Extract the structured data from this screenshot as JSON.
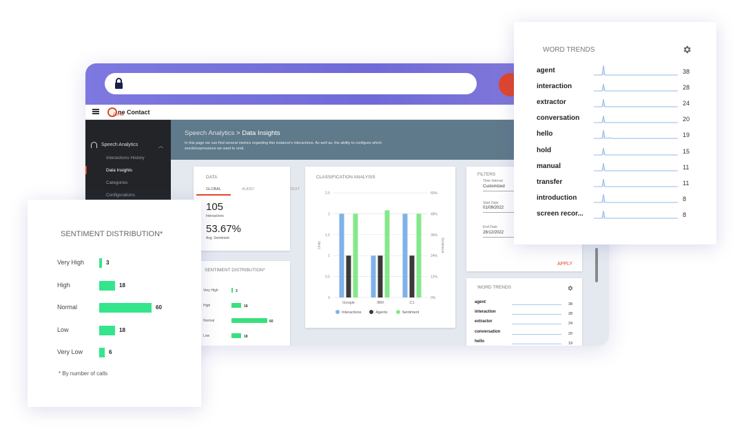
{
  "app": {
    "logo_main": "ne Contact",
    "logo_sub": "Portal"
  },
  "sidebar": {
    "section": "Speech Analytics",
    "items": [
      {
        "label": "Interactions History"
      },
      {
        "label": "Data Insights"
      },
      {
        "label": "Categories"
      },
      {
        "label": "Configurations"
      }
    ]
  },
  "header": {
    "crumb_parent": "Speech Analytics",
    "crumb_sep": ">",
    "crumb_current": "Data Insights",
    "description": "In this page we can find several metrics regarding this instance's interactions. As well as, the ability to configure which words/expressions we want to omit."
  },
  "data_card": {
    "title": "DATA",
    "tabs": [
      "GLOBAL",
      "AUDIO",
      "TEXT"
    ],
    "interactions_value": "105",
    "interactions_label": "Interactions",
    "sentiment_value": "53.67%",
    "sentiment_label": "Avg. Sentiment"
  },
  "small_sentiment": {
    "title": "SENTIMENT DISTRIBUTION*",
    "rows": [
      {
        "label": "Very High",
        "value": 3
      },
      {
        "label": "High",
        "value": 18
      },
      {
        "label": "Normal",
        "value": 60
      },
      {
        "label": "Low",
        "value": 18
      }
    ]
  },
  "classification": {
    "title": "CLASSIFICATION ANALYSIS",
    "legend": [
      "Interactions",
      "Agents",
      "Sentiment"
    ]
  },
  "chart_data": {
    "type": "bar",
    "title": "CLASSIFICATION ANALYSIS",
    "categories": [
      "Google",
      "IBM",
      "C1"
    ],
    "ylabel": "Units",
    "y2label": "Sentiment",
    "ylim": [
      0,
      2.5
    ],
    "y2lim": [
      0,
      60
    ],
    "yticks": [
      "0",
      "0.5",
      "1",
      "1.5",
      "2",
      "2.5"
    ],
    "y2ticks": [
      "0%",
      "12%",
      "24%",
      "36%",
      "48%",
      "60%"
    ],
    "series": [
      {
        "name": "Interactions",
        "axis": "left",
        "color": "#7fb2ea",
        "values": [
          2,
          1,
          2
        ]
      },
      {
        "name": "Agents",
        "axis": "left",
        "color": "#3a3a3a",
        "values": [
          1,
          1,
          1
        ]
      },
      {
        "name": "Sentiment",
        "axis": "right",
        "color": "#85e88b",
        "values": [
          48,
          50,
          48
        ]
      }
    ],
    "grid": true,
    "legend": "bottom"
  },
  "filters": {
    "title": "FILTERS",
    "time_interval_label": "Time Interval",
    "time_interval_value": "Customized",
    "start_label": "Start Date",
    "start_value": "01/09/2022",
    "end_label": "End Date",
    "end_value": "28/12/2022",
    "apply_label": "APPLY"
  },
  "small_word_trends": {
    "title": "WORD TRENDS",
    "rows": [
      {
        "word": "agent",
        "count": "38"
      },
      {
        "word": "interaction",
        "count": "28"
      },
      {
        "word": "extractor",
        "count": "24"
      },
      {
        "word": "conversation",
        "count": "20"
      },
      {
        "word": "hello",
        "count": "19"
      }
    ]
  },
  "sentiment_card": {
    "title": "SENTIMENT DISTRIBUTION*",
    "rows": [
      {
        "label": "Very High",
        "value": "3",
        "fraction": 0.05
      },
      {
        "label": "High",
        "value": "18",
        "fraction": 0.3
      },
      {
        "label": "Normal",
        "value": "60",
        "fraction": 1.0
      },
      {
        "label": "Low",
        "value": "18",
        "fraction": 0.3
      },
      {
        "label": "Very Low",
        "value": "6",
        "fraction": 0.1
      }
    ],
    "note": "* By number of calls"
  },
  "word_trends": {
    "title": "WORD TRENDS",
    "icon": "gear-icon",
    "rows": [
      {
        "word": "agent",
        "count": "38"
      },
      {
        "word": "interaction",
        "count": "28"
      },
      {
        "word": "extractor",
        "count": "24"
      },
      {
        "word": "conversation",
        "count": "20"
      },
      {
        "word": "hello",
        "count": "19"
      },
      {
        "word": "hold",
        "count": "15"
      },
      {
        "word": "manual",
        "count": "11"
      },
      {
        "word": "transfer",
        "count": "11"
      },
      {
        "word": "introduction",
        "count": "8"
      },
      {
        "word": "screen recor...",
        "count": "8"
      }
    ]
  },
  "colors": {
    "accent": "#e2452a",
    "bar_green": "#35e58b",
    "header_bg": "#5f7a8a",
    "sidebar_bg": "#222427"
  }
}
